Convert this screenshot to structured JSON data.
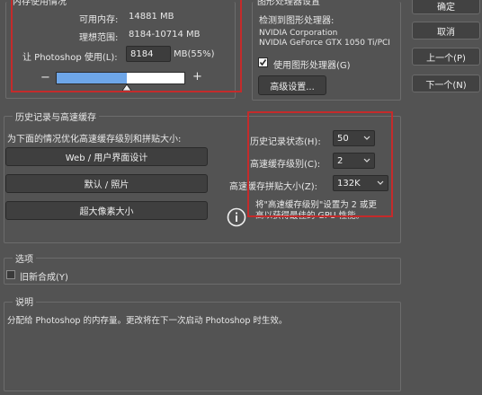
{
  "memory": {
    "section_title": "内存使用情况",
    "available_label": "可用内存:",
    "available_value": "14881 MB",
    "ideal_label": "理想范围:",
    "ideal_value": "8184-10714 MB",
    "usage_label": "让 Photoshop 使用(L):",
    "usage_value": "8184",
    "usage_unit": "MB(55%)",
    "minus": "−",
    "plus": "+",
    "slider_fraction": 0.55
  },
  "gpu": {
    "section_title": "图形处理器设置",
    "detected_label": "检测到图形处理器:",
    "vendor": "NVIDIA Corporation",
    "model": "NVIDIA GeForce GTX 1050 Ti/PCI",
    "use_gpu_label": "使用图形处理器(G)",
    "use_gpu_checked": true,
    "advanced_button": "高级设置..."
  },
  "dialog_buttons": {
    "ok": "确定",
    "cancel": "取消",
    "prev": "上一个(P)",
    "next": "下一个(N)"
  },
  "history": {
    "section_title": "历史记录与高速缓存",
    "optimize_label": "为下面的情况优化高速缓存级别和拼贴大小:",
    "preset_web": "Web / 用户界面设计",
    "preset_default": "默认 / 照片",
    "preset_huge": "超大像素大小",
    "history_states_label": "历史记录状态(H):",
    "history_states_value": "50",
    "cache_levels_label": "高速缓存级别(C):",
    "cache_levels_value": "2",
    "tile_size_label": "高速缓存拼贴大小(Z):",
    "tile_size_value": "132K",
    "hint_line1": "将\"高速缓存级别\"设置为 2 或更",
    "hint_line2": "高以获得最佳的 GPU 性能。"
  },
  "options": {
    "section_title": "选项",
    "legacy_label": "旧新合成(Y)",
    "legacy_checked": false
  },
  "description": {
    "section_title": "说明",
    "text": "分配给 Photoshop 的内存量。更改将在下一次启动 Photoshop 时生效。"
  },
  "colors": {
    "highlight_red": "#c42b2b",
    "slider_fill": "#6ea6e8"
  }
}
